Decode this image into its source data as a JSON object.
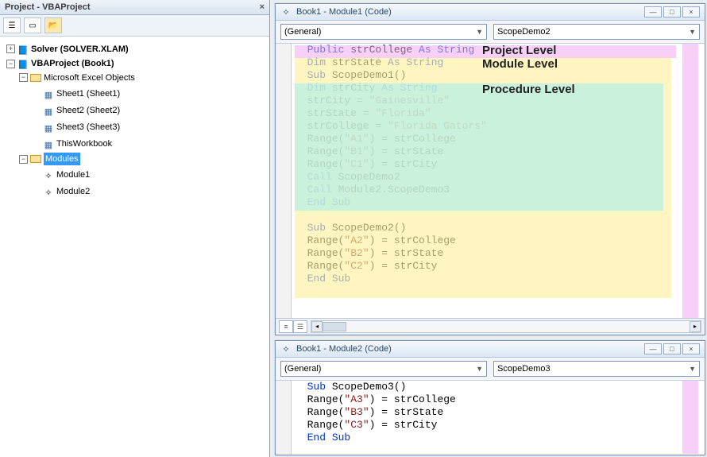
{
  "projectPanel": {
    "title": "Project - VBAProject",
    "close": "×",
    "toolbar": {
      "btn1": "☰",
      "btn2": "▭",
      "btn3": "📂"
    },
    "tree": {
      "solver": "Solver (SOLVER.XLAM)",
      "vbaproj": "VBAProject (Book1)",
      "excelObjects": "Microsoft Excel Objects",
      "sheet1": "Sheet1 (Sheet1)",
      "sheet2": "Sheet2 (Sheet2)",
      "sheet3": "Sheet3 (Sheet3)",
      "thisWb": "ThisWorkbook",
      "modulesFolder": "Modules",
      "module1": "Module1",
      "module2": "Module2"
    }
  },
  "win1": {
    "title": "Book1 - Module1 (Code)",
    "objectDd": "(General)",
    "procDd": "ScopeDemo2",
    "scopeLabels": {
      "project": "Project Level",
      "module": "Module Level",
      "procedure": "Procedure Level"
    },
    "code": {
      "l1a": "Public",
      "l1b": " strCollege ",
      "l1c": "As String",
      "l2a": "Dim",
      "l2b": " strState ",
      "l2c": "As String",
      "l3a": "Sub",
      "l3b": " ScopeDemo1()",
      "l4a": "Dim",
      "l4b": " strCity ",
      "l4c": "As String",
      "l5": "strCity = ",
      "l5s": "\"Gainesville\"",
      "l6": "strState = ",
      "l6s": "\"Florida\"",
      "l7": "strCollege = ",
      "l7s": "\"Florida Gators\"",
      "l8": "Range(",
      "l8s": "\"A1\"",
      "l8b": ") = strCollege",
      "l9": "Range(",
      "l9s": "\"B1\"",
      "l9b": ") = strState",
      "l10": "Range(",
      "l10s": "\"C1\"",
      "l10b": ") = strCity",
      "l11a": "Call",
      "l11b": " ScopeDemo2",
      "l12a": "Call",
      "l12b": " Module2.ScopeDemo3",
      "l13": "End Sub",
      "blank": "",
      "l15a": "Sub",
      "l15b": " ScopeDemo2()",
      "l16": "Range(",
      "l16s": "\"A2\"",
      "l16b": ") = strCollege",
      "l17": "Range(",
      "l17s": "\"B2\"",
      "l17b": ") = strState",
      "l18": "Range(",
      "l18s": "\"C2\"",
      "l18b": ") = strCity",
      "l19": "End Sub"
    }
  },
  "win2": {
    "title": "Book1 - Module2 (Code)",
    "objectDd": "(General)",
    "procDd": "ScopeDemo3",
    "code": {
      "l1a": "Sub",
      "l1b": " ScopeDemo3()",
      "l2": "Range(",
      "l2s": "\"A3\"",
      "l2b": ") = strCollege",
      "l3": "Range(",
      "l3s": "\"B3\"",
      "l3b": ") = strState",
      "l4": "Range(",
      "l4s": "\"C3\"",
      "l4b": ") = strCity",
      "l5": "End Sub"
    }
  }
}
